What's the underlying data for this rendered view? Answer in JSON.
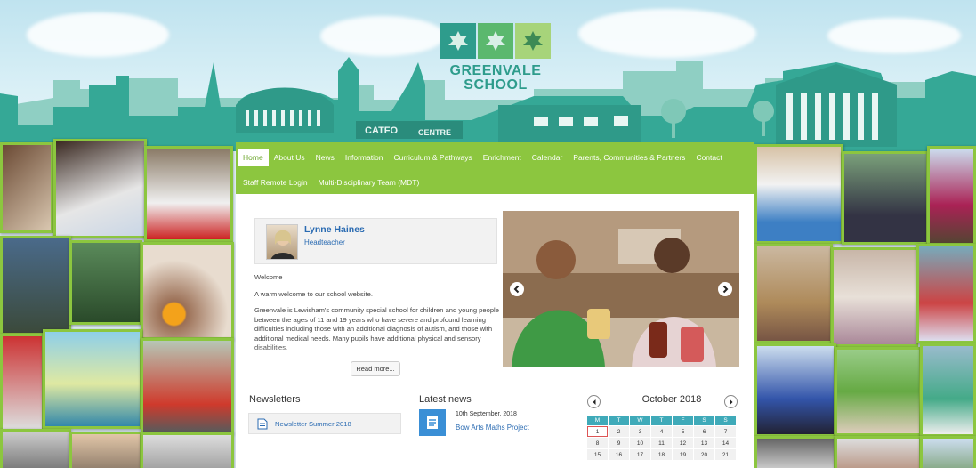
{
  "logo": {
    "line1": "GREENVALE",
    "line2": "SCHOOL"
  },
  "skyline_signs": [
    "CATFO",
    "CENTRE"
  ],
  "nav": {
    "row1": [
      "Home",
      "About Us",
      "News",
      "Information",
      "Curriculum & Pathways",
      "Enrichment",
      "Calendar",
      "Parents, Communities & Partners",
      "Contact"
    ],
    "row2": [
      "Staff Remote Login",
      "Multi-Disciplinary Team (MDT)"
    ],
    "active": "Home"
  },
  "headteacher": {
    "name": "Lynne Haines",
    "role": "Headteacher"
  },
  "welcome": {
    "heading": "Welcome",
    "intro": "A warm welcome to our school website.",
    "body": "Greenvale is Lewisham's community special school for children and young people between the ages of 11 and 19 years who have severe and profound learning difficulties including those with an additional diagnosis of autism, and those with additional medical needs. Many pupils have additional physical and sensory disabilities.",
    "read_more": "Read more..."
  },
  "newsletters": {
    "title": "Newsletters",
    "item": "Newsletter Summer 2018"
  },
  "latest_news": {
    "title": "Latest news",
    "date": "10th September, 2018",
    "headline": "Bow Arts Maths Project"
  },
  "calendar": {
    "month": "October 2018",
    "days": [
      "M",
      "T",
      "W",
      "T",
      "F",
      "S",
      "S"
    ],
    "weeks": [
      [
        "1",
        "2",
        "3",
        "4",
        "5",
        "6",
        "7"
      ],
      [
        "8",
        "9",
        "10",
        "11",
        "12",
        "13",
        "14"
      ],
      [
        "15",
        "16",
        "17",
        "18",
        "19",
        "20",
        "21"
      ]
    ],
    "today": "1"
  },
  "colors": {
    "nav_green": "#8cc63f",
    "teal": "#2e9c8c",
    "link_blue": "#2a6bb2",
    "calendar_header": "#3faab9"
  }
}
